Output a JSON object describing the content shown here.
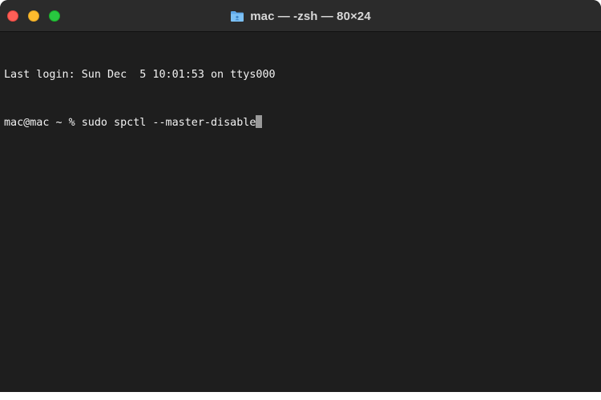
{
  "window": {
    "title": "mac — -zsh — 80×24",
    "title_icon": "folder-icon"
  },
  "terminal": {
    "lines": [
      {
        "text": "Last login: Sun Dec  5 10:01:53 on ttys000"
      },
      {
        "prompt": "mac@mac ~ % ",
        "command": "sudo spctl --master-disable"
      }
    ]
  },
  "colors": {
    "background": "#1e1e1e",
    "titlebar": "#2b2b2b",
    "text": "#f2f2f2",
    "close": "#ff5f57",
    "minimize": "#febc2e",
    "zoom": "#28c840",
    "cursor": "#9a9a9a"
  }
}
